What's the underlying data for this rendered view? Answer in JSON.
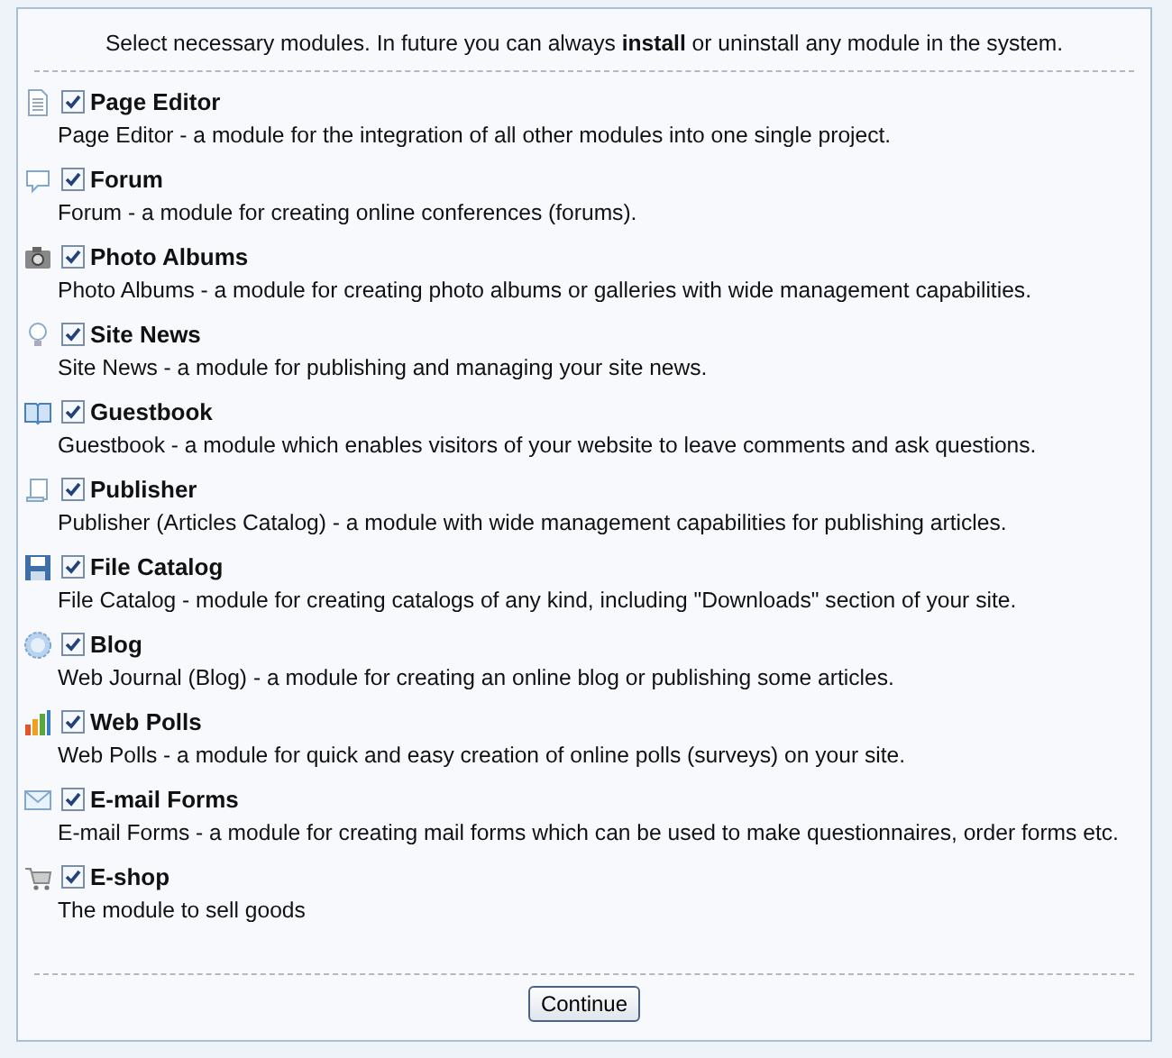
{
  "intro": "Select necessary modules. In future you can always **install** or uninstall any module in the system.",
  "modules": [
    {
      "title": "Page Editor",
      "checked": true,
      "description": "Page Editor - a module for the integration of all other modules into one single project."
    },
    {
      "title": "Forum",
      "checked": true,
      "description": "Forum - a module for creating online conferences (forums)."
    },
    {
      "title": "Photo Albums",
      "checked": true,
      "description": "Photo Albums - a module for creating photo albums or galleries with wide management capabilities."
    },
    {
      "title": "Site News",
      "checked": true,
      "description": "Site News - a module for publishing and managing your site news."
    },
    {
      "title": "Guestbook",
      "checked": true,
      "description": "Guestbook - a module which enables visitors of your website to leave comments and ask questions."
    },
    {
      "title": "Publisher",
      "checked": true,
      "description": "Publisher (Articles Catalog) - a module with wide management capabilities for publishing articles."
    },
    {
      "title": "File Catalog",
      "checked": true,
      "description": "File Catalog - module for creating catalogs of any kind, including \"Downloads\" section of your site."
    },
    {
      "title": "Blog",
      "checked": true,
      "description": "Web Journal (Blog) - a module for creating an online blog or publishing some articles."
    },
    {
      "title": "Web Polls",
      "checked": true,
      "description": "Web Polls - a module for quick and easy creation of online polls (surveys) on your site."
    },
    {
      "title": "E-mail Forms",
      "checked": true,
      "description": "E-mail Forms - a module for creating mail forms which can be used to make questionnaires, order forms etc."
    },
    {
      "title": "E-shop",
      "checked": true,
      "description": "The module to sell goods"
    }
  ],
  "continue_button": "Continue"
}
